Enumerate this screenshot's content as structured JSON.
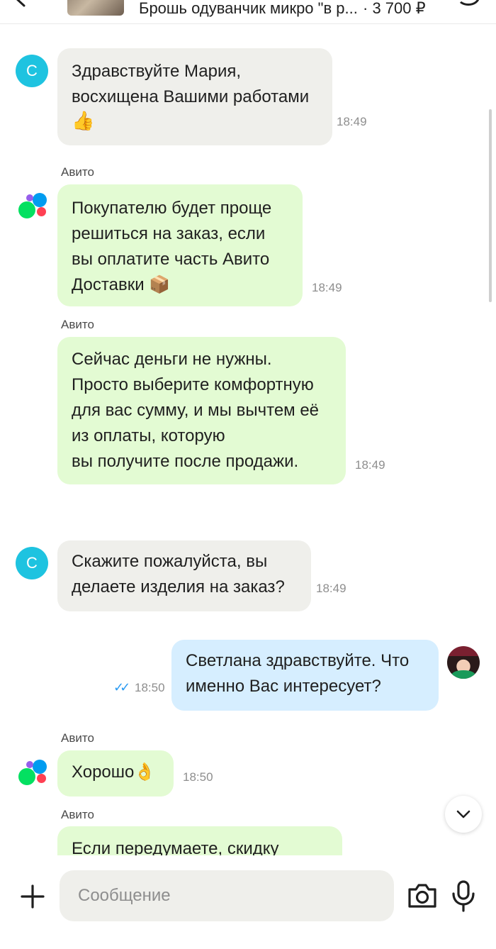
{
  "header": {
    "listing_title": "Брошь одуванчик микро \"в р...",
    "price": "· 3 700 ₽",
    "back_icon": "back-arrow-icon",
    "menu_icon": "more-icon"
  },
  "messages": [
    {
      "type": "incoming",
      "avatar_letter": "С",
      "lines": [
        "Здравствуйте Мария,",
        "восхищена Вашими работами"
      ],
      "emoji": "👍",
      "time": "18:49"
    },
    {
      "type": "system",
      "sender": "Авито",
      "lines": [
        "Покупателю будет проще",
        "решиться на заказ, если",
        "вы оплатите часть Авито",
        "Доставки 📦"
      ],
      "time": "18:49"
    },
    {
      "type": "system",
      "sender": "Авито",
      "lines": [
        "Сейчас деньги не нужны.",
        "Просто выберите комфортную",
        "для вас сумму, и мы вычтем её",
        "из оплаты, которую",
        "вы получите после продажи."
      ],
      "time": "18:49"
    },
    {
      "type": "incoming",
      "avatar_letter": "С",
      "lines": [
        "Скажите пожалуйста, вы",
        "делаете изделия на заказ?"
      ],
      "time": "18:49"
    },
    {
      "type": "outgoing",
      "lines": [
        "Светлана здравствуйте. Что",
        "именно Вас интересует?"
      ],
      "time": "18:50",
      "status": "read"
    },
    {
      "type": "system",
      "sender": "Авито",
      "lines": [
        "Хорошо👌"
      ],
      "time": "18:50"
    },
    {
      "type": "system",
      "sender": "Авито",
      "lines": [
        "Если передумаете, скидку"
      ]
    }
  ],
  "composer": {
    "placeholder": "Сообщение",
    "attach_icon": "plus-icon",
    "camera_icon": "camera-icon",
    "mic_icon": "microphone-icon"
  },
  "colors": {
    "incoming_bubble": "#efefeb",
    "system_bubble": "#e3fbd3",
    "outgoing_bubble": "#d6eeff",
    "avatar_c": "#1ec3e0",
    "read_checks": "#2b9bf2"
  }
}
